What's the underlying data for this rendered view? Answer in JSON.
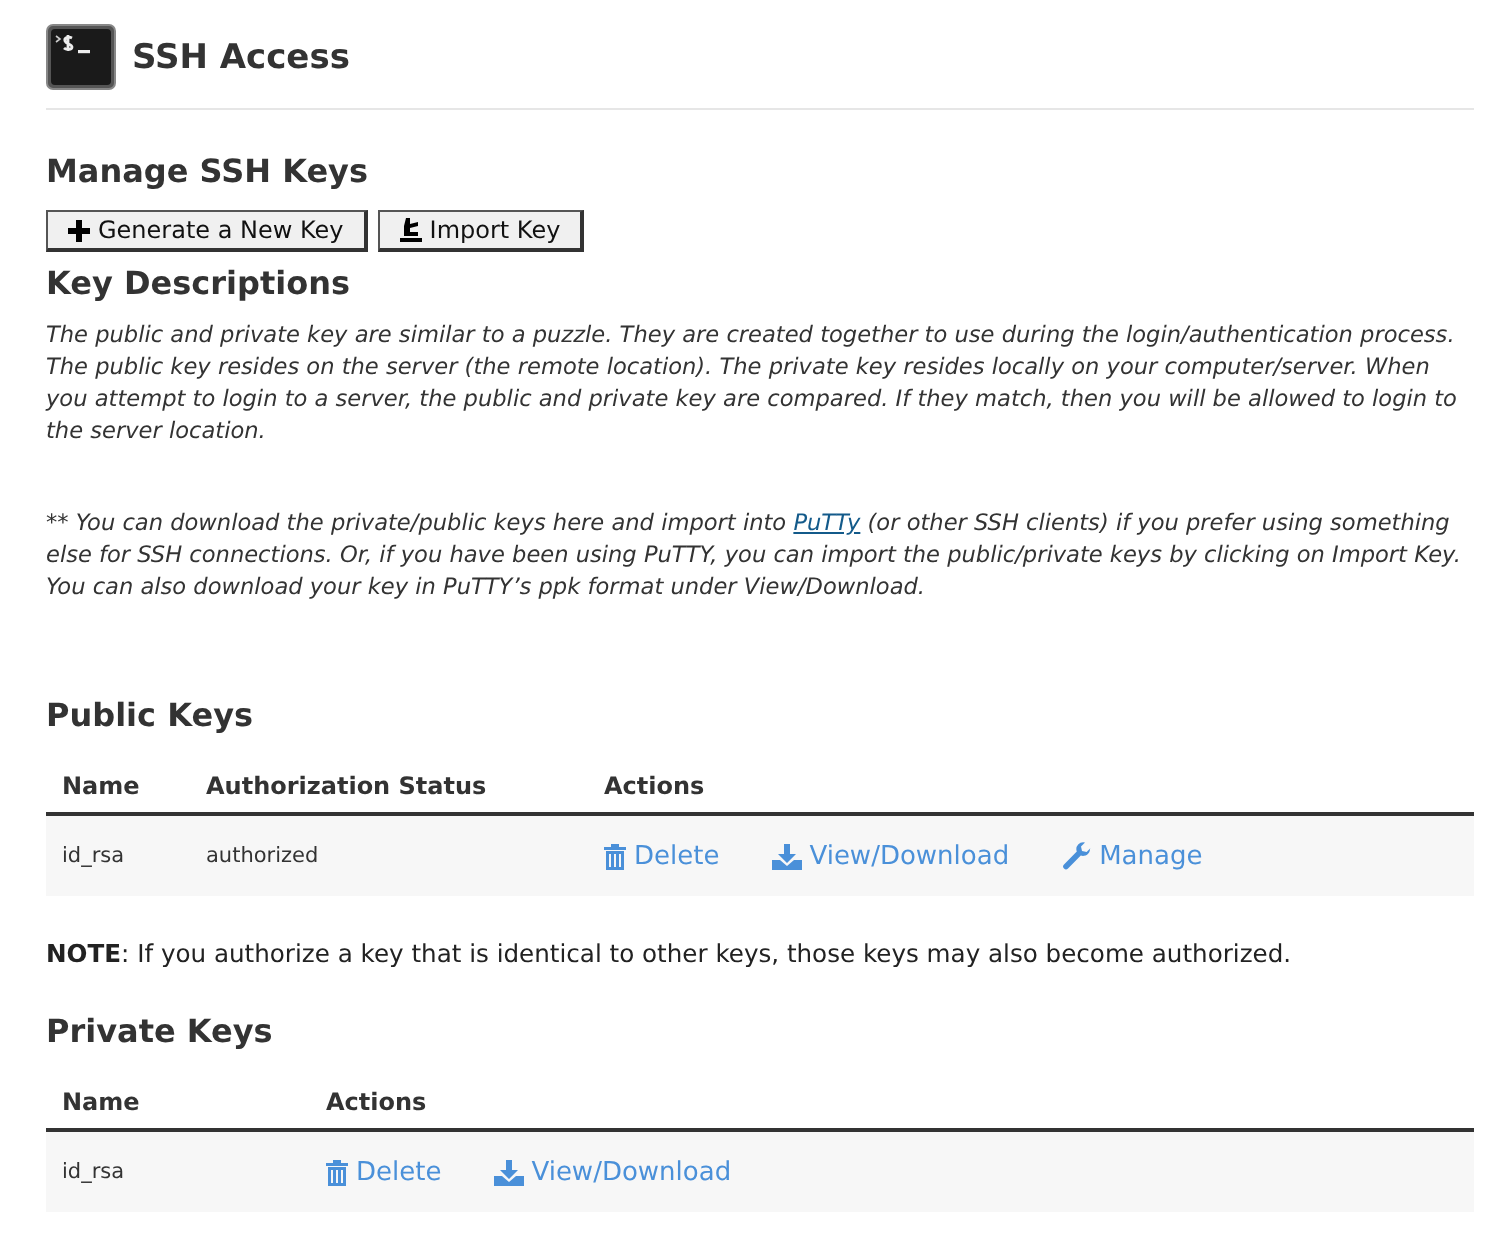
{
  "header": {
    "title": "SSH Access"
  },
  "manage": {
    "heading": "Manage SSH Keys",
    "buttons": [
      {
        "label": "Generate a New Key",
        "kind": "generate"
      },
      {
        "label": "Import Key",
        "kind": "import"
      }
    ]
  },
  "descriptions": {
    "heading": "Key Descriptions",
    "paragraphs": [
      {
        "before": "The public and private key are similar to a puzzle. They are created together to use during the login/authentication process. The public key resides on the server (the remote location). The private key resides locally on your computer/server. When you attempt to login to a server, the public and private key are compared. If they match, then you will be allowed to login to the server location."
      },
      {
        "before": "** You can download the private/public keys here and import into ",
        "link": "PuTTy",
        "after": " (or other SSH clients) if you prefer using something else for SSH connections. Or, if you have been using PuTTY, you can import the public/private keys by clicking on Import Key. You can also download your key in PuTTY’s ppk format under View/Download."
      }
    ]
  },
  "public_keys": {
    "heading": "Public Keys",
    "columns": [
      "Name",
      "Authorization Status",
      "Actions"
    ],
    "rows": [
      {
        "name": "id_rsa",
        "status": "authorized",
        "actions": [
          {
            "label": "Delete",
            "kind": "delete"
          },
          {
            "label": "View/Download",
            "kind": "download"
          },
          {
            "label": "Manage",
            "kind": "manage"
          }
        ]
      }
    ]
  },
  "note": "**NOTE**: If you authorize a key that is identical to other keys, those keys may also become authorized.",
  "private_keys": {
    "heading": "Private Keys",
    "columns": [
      "Name",
      "Actions"
    ],
    "rows": [
      {
        "name": "id_rsa",
        "actions": [
          {
            "label": "Delete",
            "kind": "delete"
          },
          {
            "label": "View/Download",
            "kind": "download"
          }
        ]
      }
    ]
  }
}
